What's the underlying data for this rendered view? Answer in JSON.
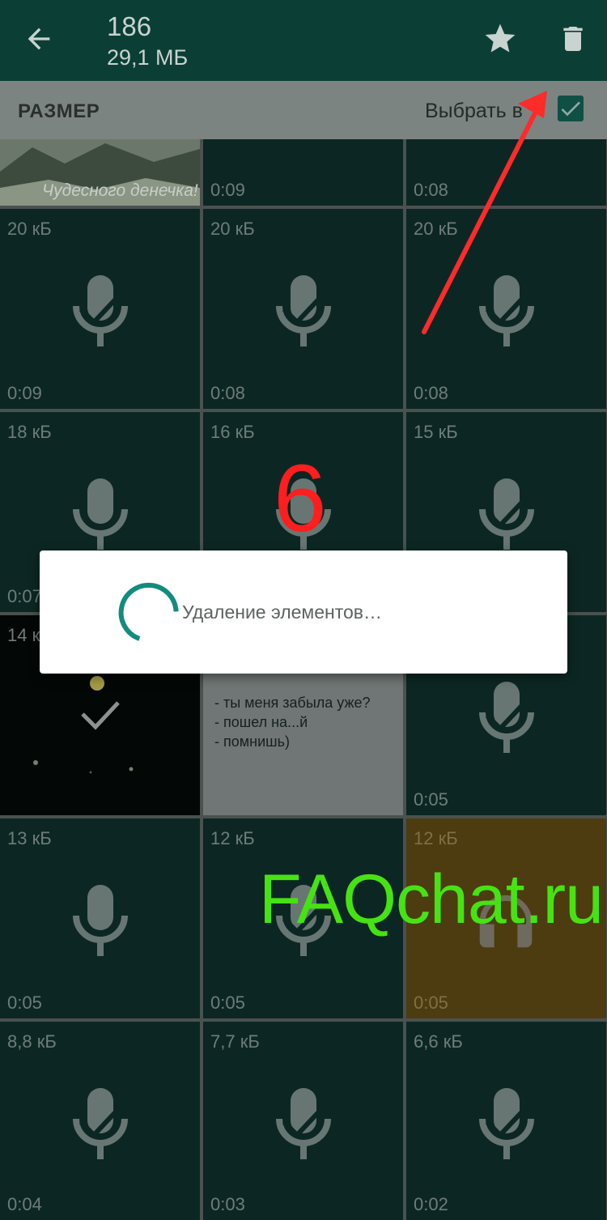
{
  "header": {
    "count": "186",
    "total_size": "29,1 МБ"
  },
  "sortbar": {
    "sort_label": "РАЗМЕР",
    "select_all_label": "Выбрать в"
  },
  "grid": {
    "row0": [
      {
        "size": "",
        "duration": "",
        "caption": "Чудесного денечка!"
      },
      {
        "size": "",
        "duration": "0:09"
      },
      {
        "size": "",
        "duration": "0:08"
      }
    ],
    "row1": [
      {
        "size": "20 кБ",
        "duration": "0:09"
      },
      {
        "size": "20 кБ",
        "duration": "0:08"
      },
      {
        "size": "20 кБ",
        "duration": "0:08"
      }
    ],
    "row2": [
      {
        "size": "18 кБ",
        "duration": "0:07"
      },
      {
        "size": "16 кБ",
        "duration": ""
      },
      {
        "size": "15 кБ",
        "duration": ""
      }
    ],
    "row3": [
      {
        "size": "14 к",
        "duration": ""
      },
      {
        "size": "",
        "duration": "",
        "text_lines": [
          "- ты меня забыла уже?",
          "- пошел на...й",
          "- помнишь)"
        ]
      },
      {
        "size": "",
        "duration": "0:05"
      }
    ],
    "row4": [
      {
        "size": "13 кБ",
        "duration": "0:05"
      },
      {
        "size": "12 кБ",
        "duration": "0:05"
      },
      {
        "size": "12 кБ",
        "duration": "0:05"
      }
    ],
    "row5": [
      {
        "size": "8,8 кБ",
        "duration": "0:04"
      },
      {
        "size": "7,7 кБ",
        "duration": "0:03"
      },
      {
        "size": "6,6 кБ",
        "duration": "0:02"
      }
    ]
  },
  "dialog": {
    "message": "Удаление элементов…"
  },
  "annotation": {
    "step_number": "6",
    "watermark": "FAQchat.ru"
  },
  "colors": {
    "appbar": "#0b3f36",
    "accent": "#128c7e",
    "annotation_red": "#ff1e1e",
    "watermark_green": "#46e312"
  }
}
